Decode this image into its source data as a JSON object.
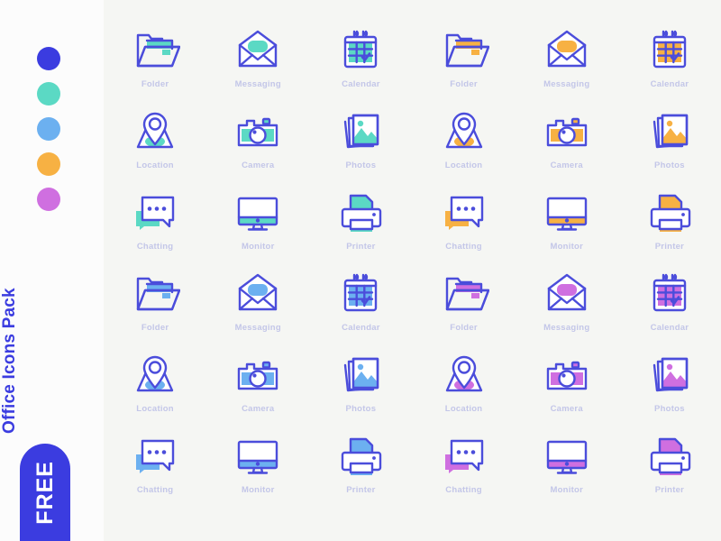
{
  "sidebar": {
    "swatches": [
      {
        "name": "indigo",
        "hex": "#3b3ce0"
      },
      {
        "name": "mint",
        "hex": "#5bd9c4"
      },
      {
        "name": "sky",
        "hex": "#6cb0f0"
      },
      {
        "name": "amber",
        "hex": "#f7b143"
      },
      {
        "name": "orchid",
        "hex": "#cf6fe0"
      }
    ],
    "pack_title": "Office Icons Pack",
    "free_badge_label": "FREE",
    "free_badge_color": "#3b3ce0",
    "title_color": "#3b3ce0"
  },
  "theme": {
    "rail_background": "#fcfcfc",
    "stage_background": "#f5f6f3",
    "stroke_color": "#4b4ddb",
    "label_color": "#c3c6e8"
  },
  "grid": {
    "columns": 6,
    "rows": 6,
    "icon_names": [
      "Folder",
      "Messaging",
      "Calendar",
      "Location",
      "Camera",
      "Photos",
      "Chatting",
      "Monitor",
      "Printer"
    ],
    "cells": [
      {
        "icon": "folder",
        "label": "Folder",
        "fill": "#5bd9c4"
      },
      {
        "icon": "messaging",
        "label": "Messaging",
        "fill": "#5bd9c4"
      },
      {
        "icon": "calendar",
        "label": "Calendar",
        "fill": "#5bd9c4"
      },
      {
        "icon": "folder",
        "label": "Folder",
        "fill": "#f7b143"
      },
      {
        "icon": "messaging",
        "label": "Messaging",
        "fill": "#f7b143"
      },
      {
        "icon": "calendar",
        "label": "Calendar",
        "fill": "#f7b143"
      },
      {
        "icon": "location",
        "label": "Location",
        "fill": "#5bd9c4"
      },
      {
        "icon": "camera",
        "label": "Camera",
        "fill": "#5bd9c4"
      },
      {
        "icon": "photos",
        "label": "Photos",
        "fill": "#5bd9c4"
      },
      {
        "icon": "location",
        "label": "Location",
        "fill": "#f7b143"
      },
      {
        "icon": "camera",
        "label": "Camera",
        "fill": "#f7b143"
      },
      {
        "icon": "photos",
        "label": "Photos",
        "fill": "#f7b143"
      },
      {
        "icon": "chatting",
        "label": "Chatting",
        "fill": "#5bd9c4"
      },
      {
        "icon": "monitor",
        "label": "Monitor",
        "fill": "#5bd9c4"
      },
      {
        "icon": "printer",
        "label": "Printer",
        "fill": "#5bd9c4"
      },
      {
        "icon": "chatting",
        "label": "Chatting",
        "fill": "#f7b143"
      },
      {
        "icon": "monitor",
        "label": "Monitor",
        "fill": "#f7b143"
      },
      {
        "icon": "printer",
        "label": "Printer",
        "fill": "#f7b143"
      },
      {
        "icon": "folder",
        "label": "Folder",
        "fill": "#6cb0f0"
      },
      {
        "icon": "messaging",
        "label": "Messaging",
        "fill": "#6cb0f0"
      },
      {
        "icon": "calendar",
        "label": "Calendar",
        "fill": "#6cb0f0"
      },
      {
        "icon": "folder",
        "label": "Folder",
        "fill": "#cf6fe0"
      },
      {
        "icon": "messaging",
        "label": "Messaging",
        "fill": "#cf6fe0"
      },
      {
        "icon": "calendar",
        "label": "Calendar",
        "fill": "#cf6fe0"
      },
      {
        "icon": "location",
        "label": "Location",
        "fill": "#6cb0f0"
      },
      {
        "icon": "camera",
        "label": "Camera",
        "fill": "#6cb0f0"
      },
      {
        "icon": "photos",
        "label": "Photos",
        "fill": "#6cb0f0"
      },
      {
        "icon": "location",
        "label": "Location",
        "fill": "#cf6fe0"
      },
      {
        "icon": "camera",
        "label": "Camera",
        "fill": "#cf6fe0"
      },
      {
        "icon": "photos",
        "label": "Photos",
        "fill": "#cf6fe0"
      },
      {
        "icon": "chatting",
        "label": "Chatting",
        "fill": "#6cb0f0"
      },
      {
        "icon": "monitor",
        "label": "Monitor",
        "fill": "#6cb0f0"
      },
      {
        "icon": "printer",
        "label": "Printer",
        "fill": "#6cb0f0"
      },
      {
        "icon": "chatting",
        "label": "Chatting",
        "fill": "#cf6fe0"
      },
      {
        "icon": "monitor",
        "label": "Monitor",
        "fill": "#cf6fe0"
      },
      {
        "icon": "printer",
        "label": "Printer",
        "fill": "#cf6fe0"
      }
    ]
  }
}
